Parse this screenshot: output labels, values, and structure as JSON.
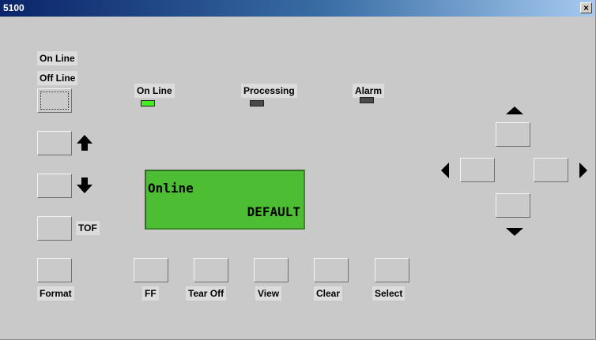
{
  "window": {
    "title": "5100",
    "close_glyph": "×"
  },
  "mode_labels": {
    "on_line": "On Line",
    "off_line": "Off Line"
  },
  "status": {
    "online": {
      "label": "On Line",
      "led": "on",
      "led_color": "#44ee22"
    },
    "processing": {
      "label": "Processing",
      "led": "off"
    },
    "alarm": {
      "label": "Alarm",
      "led": "off"
    }
  },
  "display": {
    "line1": "Online",
    "line2": "DEFAULT",
    "background": "#4dbd33"
  },
  "side_labels": {
    "tof": "TOF"
  },
  "bottom_buttons": {
    "format": "Format",
    "ff": "FF",
    "tear_off": "Tear Off",
    "view": "View",
    "clear": "Clear",
    "select": "Select"
  },
  "icons": {
    "up": "arrow-up-icon",
    "down": "arrow-down-icon",
    "nav_up": "triangle-up-icon",
    "nav_down": "triangle-down-icon",
    "nav_left": "triangle-left-icon",
    "nav_right": "triangle-right-icon"
  }
}
